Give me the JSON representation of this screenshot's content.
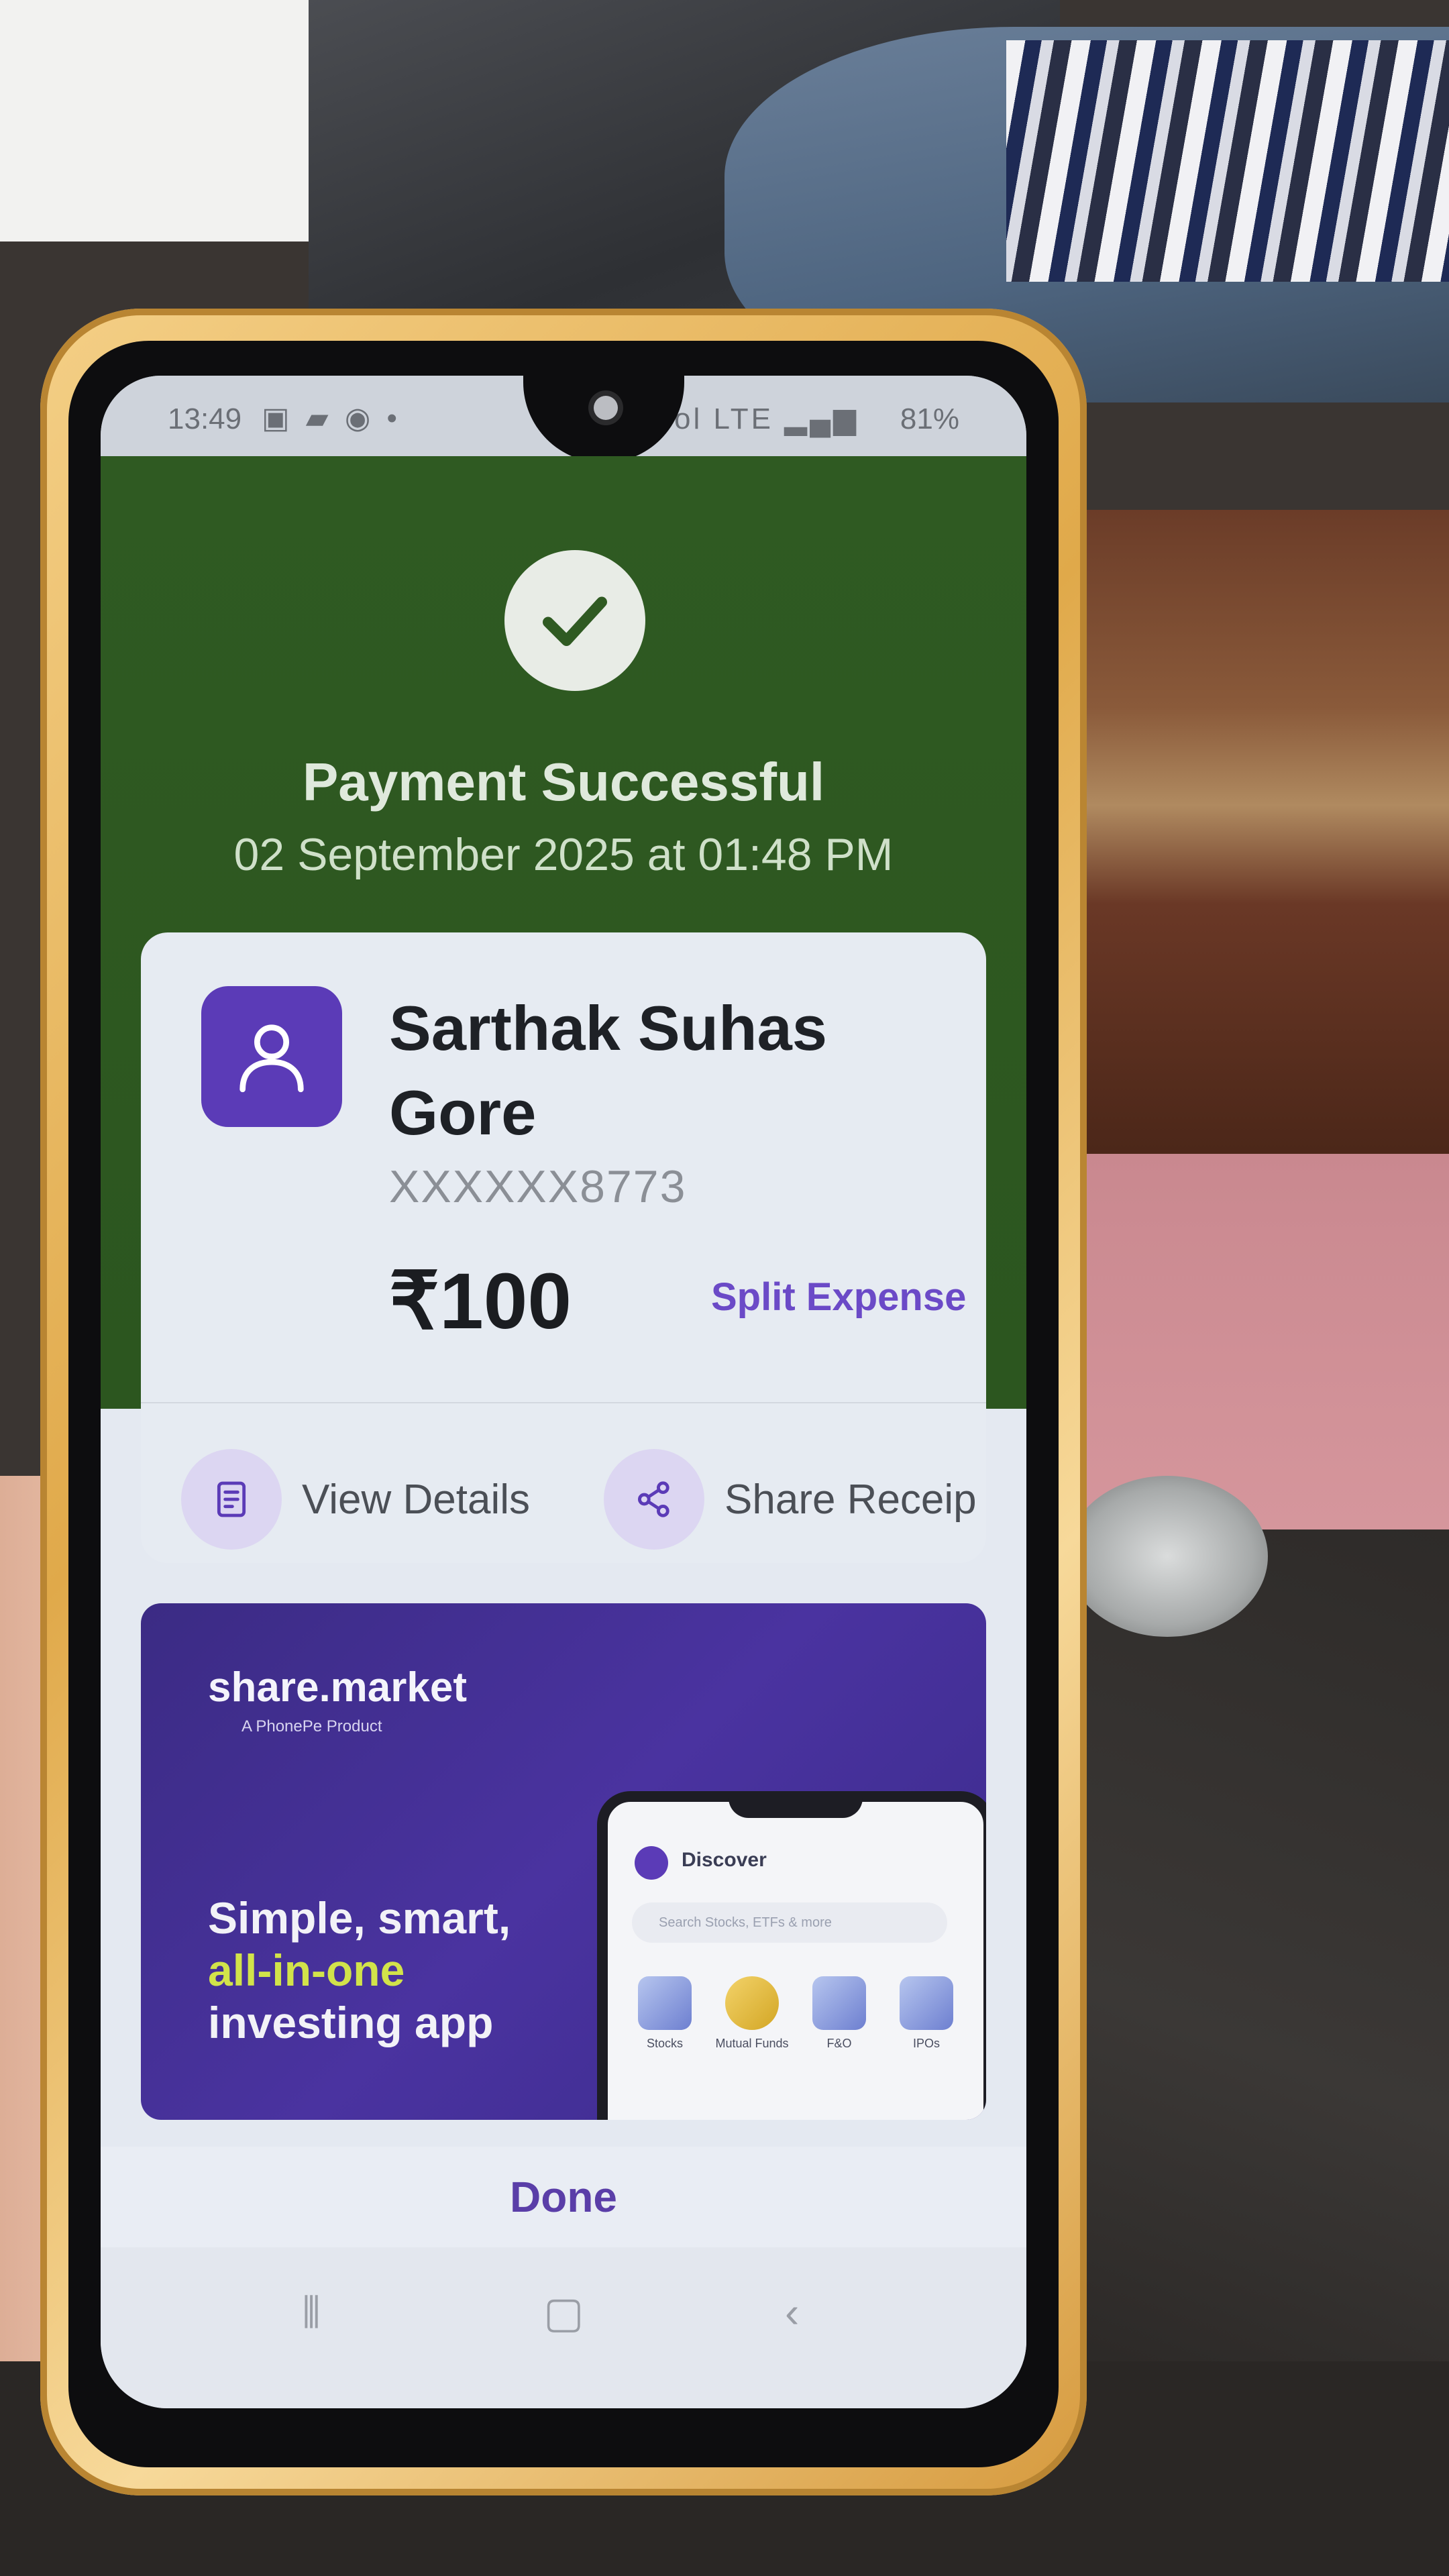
{
  "status_bar": {
    "time": "13:49",
    "left_icons": "▣ ▰ ◉ •",
    "right_icons": "⏰ ⊘ Vol LTE ▂▄▆",
    "battery": "81%"
  },
  "header": {
    "title": "Payment Successful",
    "date": "02 September 2025 at 01:48 PM"
  },
  "recipient": {
    "name": "Sarthak Suhas Gore",
    "account": "XXXXXX8773",
    "amount": "₹100",
    "split_label": "Split Expense"
  },
  "actions": {
    "view_details": "View Details",
    "share_receipt": "Share Receip"
  },
  "ad": {
    "logo": "share.market",
    "sublogo": "A PhonePe Product",
    "line1": "Simple, smart,",
    "line2": "all-in-one",
    "line3": "investing app",
    "mini_title": "Discover",
    "mini_search": "Search Stocks, ETFs & more",
    "mini_items": [
      "Stocks",
      "Mutual Funds",
      "F&O",
      "IPOs"
    ]
  },
  "footer": {
    "done_label": "Done"
  },
  "colors": {
    "header_green": "#2f5a22",
    "accent_purple": "#5b3bb7",
    "ad_purple": "#3b2b84",
    "highlight_yellow": "#d2e34a"
  }
}
